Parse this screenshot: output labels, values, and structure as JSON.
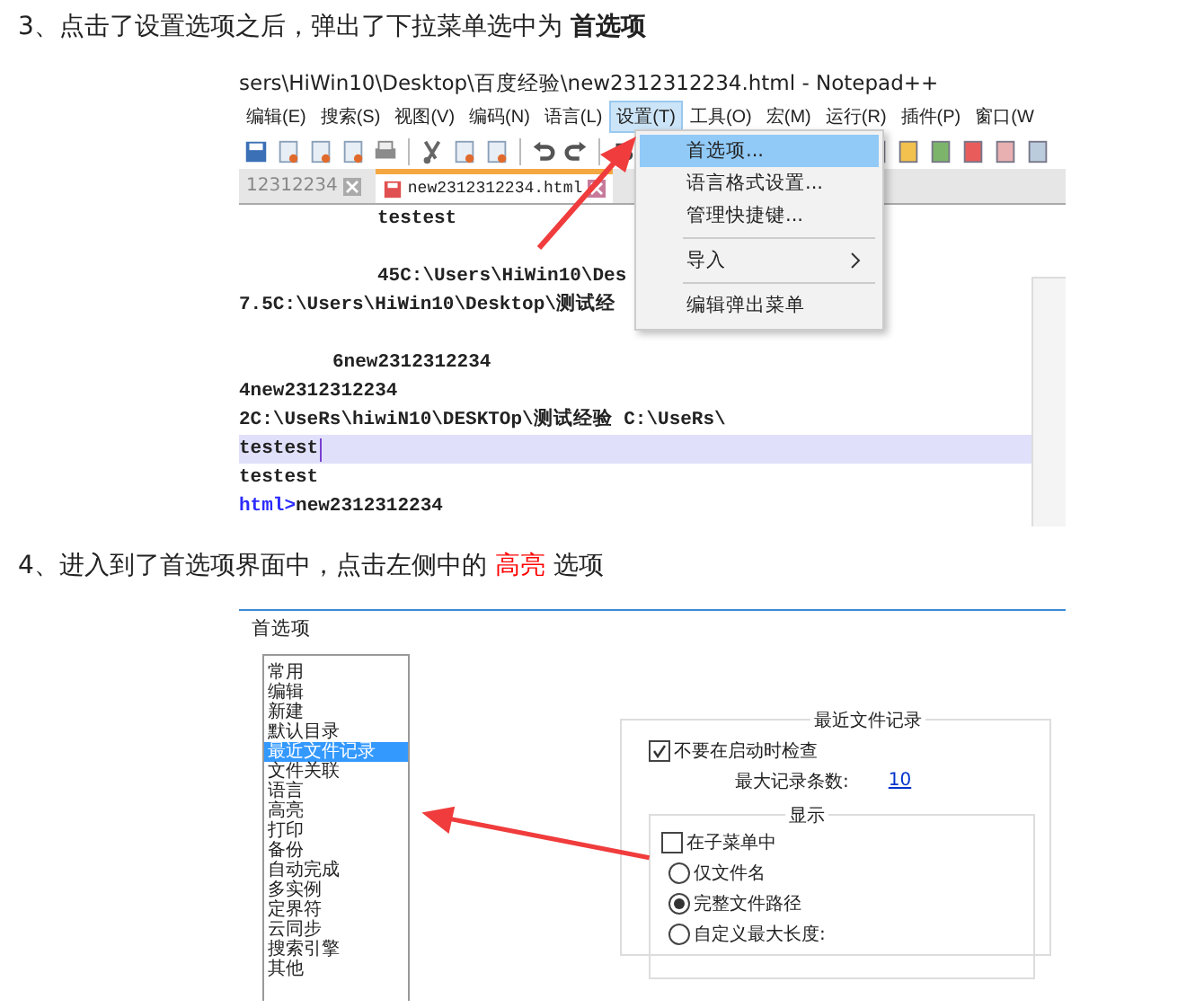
{
  "steps": [
    {
      "segments": [
        {
          "text": "3、点击了设置选项之后，弹出了下拉菜单选中为 ",
          "kind": "plain"
        },
        {
          "text": "首选项",
          "kind": "bold"
        }
      ]
    },
    {
      "segments": [
        {
          "text": "4、进入到了首选项界面中，点击左侧中的 ",
          "kind": "plain"
        },
        {
          "text": "高亮",
          "kind": "highlight"
        },
        {
          "text": " 选项",
          "kind": "plain"
        }
      ]
    }
  ],
  "notepad": {
    "title": "sers\\HiWin10\\Desktop\\百度经验\\new2312312234.html - Notepad++",
    "menu": [
      {
        "label": "编辑(E)",
        "selected": false
      },
      {
        "label": "搜索(S)",
        "selected": false
      },
      {
        "label": "视图(V)",
        "selected": false
      },
      {
        "label": "编码(N)",
        "selected": false
      },
      {
        "label": "语言(L)",
        "selected": false
      },
      {
        "label": "设置(T)",
        "selected": true
      },
      {
        "label": "工具(O)",
        "selected": false
      },
      {
        "label": "宏(M)",
        "selected": false
      },
      {
        "label": "运行(R)",
        "selected": false
      },
      {
        "label": "插件(P)",
        "selected": false
      },
      {
        "label": "窗口(W",
        "selected": false
      }
    ],
    "tabs": [
      {
        "label": "12312234",
        "selected": false
      },
      {
        "label": "new2312312234.html",
        "selected": true
      }
    ],
    "lines": [
      {
        "kind": "deep",
        "current": false,
        "segments": [
          {
            "text": "testest",
            "kind": "plain"
          }
        ]
      },
      {
        "kind": "blank",
        "current": false
      },
      {
        "kind": "deep",
        "current": false,
        "segments": [
          {
            "text": "45C:\\Users\\HiWin10\\Des",
            "kind": "plain"
          }
        ]
      },
      {
        "kind": "flush",
        "current": false,
        "segments": [
          {
            "text": "7.5C:\\Users\\HiWin10\\Desktop\\测试经",
            "kind": "plain"
          }
        ]
      },
      {
        "kind": "blank",
        "current": false
      },
      {
        "kind": "mid",
        "current": false,
        "segments": [
          {
            "text": "6new2312312234",
            "kind": "plain"
          }
        ]
      },
      {
        "kind": "flush",
        "current": false,
        "segments": [
          {
            "text": "4new2312312234",
            "kind": "plain"
          }
        ]
      },
      {
        "kind": "flush",
        "current": false,
        "segments": [
          {
            "text": "2C:\\UseRs\\hiwiN10\\DESKTOp\\测试经验 C:\\UseRs\\",
            "kind": "plain"
          }
        ]
      },
      {
        "kind": "flush",
        "current": true,
        "segments": [
          {
            "text": "testest",
            "kind": "plain"
          }
        ]
      },
      {
        "kind": "flush",
        "current": false,
        "segments": [
          {
            "text": "testest",
            "kind": "plain"
          }
        ]
      },
      {
        "kind": "flush",
        "current": false,
        "segments": [
          {
            "text": "html>",
            "kind": "tag"
          },
          {
            "text": "new2312312234",
            "kind": "plain"
          }
        ]
      }
    ],
    "dropdown": [
      {
        "kind": "item",
        "label": "首选项...",
        "selected": true
      },
      {
        "kind": "item",
        "label": "语言格式设置...",
        "selected": false
      },
      {
        "kind": "item",
        "label": "管理快捷键...",
        "selected": false
      },
      {
        "kind": "separator"
      },
      {
        "kind": "submenu",
        "label": "导入",
        "selected": false
      },
      {
        "kind": "separator"
      },
      {
        "kind": "item",
        "label": "编辑弹出菜单",
        "selected": false
      }
    ]
  },
  "preferences": {
    "title": "首选项",
    "categories": [
      {
        "label": "常用",
        "selected": false
      },
      {
        "label": "编辑",
        "selected": false
      },
      {
        "label": "新建",
        "selected": false
      },
      {
        "label": "默认目录",
        "selected": false
      },
      {
        "label": "最近文件记录",
        "selected": true
      },
      {
        "label": "文件关联",
        "selected": false
      },
      {
        "label": "语言",
        "selected": false
      },
      {
        "label": "高亮",
        "selected": false
      },
      {
        "label": "打印",
        "selected": false
      },
      {
        "label": "备份",
        "selected": false
      },
      {
        "label": "自动完成",
        "selected": false
      },
      {
        "label": "多实例",
        "selected": false
      },
      {
        "label": "定界符",
        "selected": false
      },
      {
        "label": "云同步",
        "selected": false
      },
      {
        "label": "搜索引擎",
        "selected": false
      },
      {
        "label": "其他",
        "selected": false
      }
    ],
    "recent": {
      "legend": "最近文件记录",
      "dont_check": {
        "label": "不要在启动时检查",
        "checked": true
      },
      "max_label": "最大记录条数:",
      "max_value": "10",
      "display": {
        "legend": "显示",
        "in_submenu": {
          "label": "在子菜单中",
          "checked": false
        },
        "options": [
          {
            "label": "仅文件名",
            "selected": false
          },
          {
            "label": "完整文件路径",
            "selected": true
          },
          {
            "label": "自定义最大长度:",
            "selected": false
          }
        ]
      }
    }
  }
}
